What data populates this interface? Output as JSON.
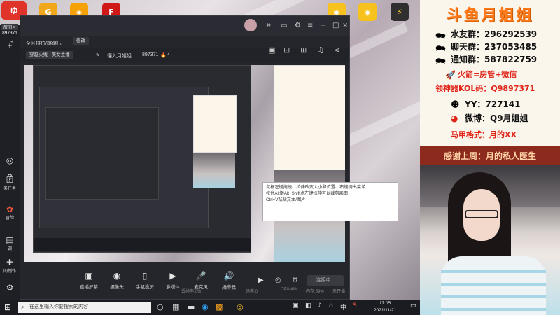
{
  "desktop": {
    "icons": [
      {
        "name": "app-icon-1",
        "label": "",
        "glyph": "ゆ",
        "color": "#e0332a"
      },
      {
        "name": "app-icon-2",
        "label": "",
        "glyph": "G",
        "color": "#f0a81a"
      },
      {
        "name": "app-icon-3",
        "label": "",
        "glyph": "◈",
        "color": "#f5a20a"
      },
      {
        "name": "app-icon-4",
        "label": "",
        "glyph": "F",
        "color": "#d01818"
      },
      {
        "name": "app-icon-5",
        "label": "",
        "glyph": "◉",
        "color": "#f7c21e"
      },
      {
        "name": "app-icon-6",
        "label": "",
        "glyph": "◉",
        "color": "#f7c21e"
      },
      {
        "name": "app-icon-7",
        "label": "",
        "glyph": "⚡",
        "color": "#f2c12e"
      }
    ]
  },
  "leftbar": {
    "room_label": "房间号",
    "room_number": "897371",
    "items": [
      {
        "label": "",
        "glyph": "+"
      },
      {
        "label": "",
        "glyph": "◎"
      },
      {
        "label": "",
        "glyph": "?"
      },
      {
        "label": "务任务",
        "glyph": "☑"
      },
      {
        "label": "冒险",
        "glyph": "✿"
      },
      {
        "label": "调",
        "glyph": "▤"
      },
      {
        "label": "间制作",
        "glyph": "✚"
      },
      {
        "label": "",
        "glyph": "⚙"
      }
    ]
  },
  "obs": {
    "category": "全区排位/跳跳乐",
    "edit": "修改",
    "tag1": "穿越火线 · 美女主播",
    "tag2": "懂入月姐姐",
    "room_num": "897371",
    "hot": "4",
    "toolbar": [
      {
        "glyph": "▣",
        "label": "直播屏幕"
      },
      {
        "glyph": "◉",
        "label": "摄像头"
      },
      {
        "glyph": "▯",
        "label": "手机投屏"
      },
      {
        "glyph": "▶",
        "label": "多媒体"
      },
      {
        "glyph": "🎤",
        "label": "麦克风"
      },
      {
        "glyph": "🔊",
        "label": "扬声器"
      }
    ],
    "live_button": "连接中...",
    "status": [
      "丢帧率:0%",
      "FPS:30",
      "码率:0",
      "CPU:4%",
      "内存:59%",
      "未开播"
    ],
    "tooltip": [
      "鼠标左键拖拽、拉伸改变大小和位置、右键调出菜单",
      "按住Alt键Alt+Shift点左键拉伸可以裁剪画面",
      "Ctrl+V粘贴文本/图片"
    ]
  },
  "taskbar": {
    "search_placeholder": "在这里输入你要搜索的内容",
    "time": "17:05",
    "date": "2021/11/21",
    "lang": "中"
  },
  "poster": {
    "title": "斗鱼月姐姐",
    "lines": [
      {
        "icon": "group-icon",
        "label": "水友群：296292539",
        "color": "#111111"
      },
      {
        "icon": "group-icon",
        "label": "聊天群：237053485",
        "color": "#111111"
      },
      {
        "icon": "group-icon",
        "label": "通知群：587822759",
        "color": "#111111"
      },
      {
        "icon": "rocket-icon",
        "label": "火箭=房管+微信",
        "color": "#e0261b"
      },
      {
        "icon": "",
        "label": "领神器KOL码：Q9897371",
        "color": "#e0261b"
      },
      {
        "icon": "yy-icon",
        "label": "YY：727141",
        "color": "#111111"
      },
      {
        "icon": "weibo-icon",
        "label": "微博：Q9月姐姐",
        "color": "#111111"
      },
      {
        "icon": "",
        "label": "马甲格式：月的XX",
        "color": "#e0261b"
      }
    ],
    "thanks": "感谢上周：月的私人医生"
  }
}
